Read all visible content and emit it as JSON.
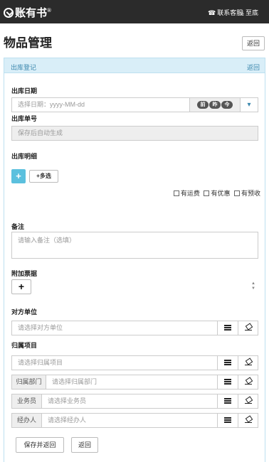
{
  "header": {
    "brand": "账有书",
    "brand_mark": "®",
    "contact_label": "联系客服",
    "bottom_label": "至底"
  },
  "page": {
    "title": "物品管理",
    "back_label": "返回"
  },
  "panel": {
    "title": "出库登记",
    "back_label": "返回"
  },
  "form": {
    "date": {
      "label": "出库日期",
      "placeholder": "选择日期：yyyy-MM-dd",
      "pills": [
        "前",
        "昨",
        "今"
      ],
      "dropdown_glyph": "▾"
    },
    "number": {
      "label": "出库单号",
      "placeholder": "保存后自动生成"
    },
    "details": {
      "label": "出库明细",
      "add_glyph": "+",
      "multi_label": "+多选"
    },
    "options": [
      {
        "label": "有运费",
        "checked": false
      },
      {
        "label": "有优惠",
        "checked": false
      },
      {
        "label": "有预收",
        "checked": false
      }
    ],
    "remark": {
      "label": "备注",
      "placeholder": "请输入备注（选填）"
    },
    "attachment": {
      "label": "附加票据",
      "add_glyph": "+"
    },
    "counterparty": {
      "label": "对方单位",
      "placeholder": "请选择对方单位"
    },
    "project": {
      "label": "归属项目",
      "placeholder": "请选择归属项目"
    },
    "department": {
      "addon": "归属部门",
      "placeholder": "请选择归属部门"
    },
    "salesman": {
      "addon": "业务员",
      "placeholder": "请选择业务员"
    },
    "handler": {
      "addon": "经办人",
      "placeholder": "请选择经办人"
    }
  },
  "footer": {
    "save_back_label": "保存并返回",
    "back_label": "返回"
  },
  "colors": {
    "topbar": "#2b2b2b",
    "panel_head": "#d9eef8",
    "panel_text": "#3a87ad",
    "add_button": "#5bc0de"
  }
}
